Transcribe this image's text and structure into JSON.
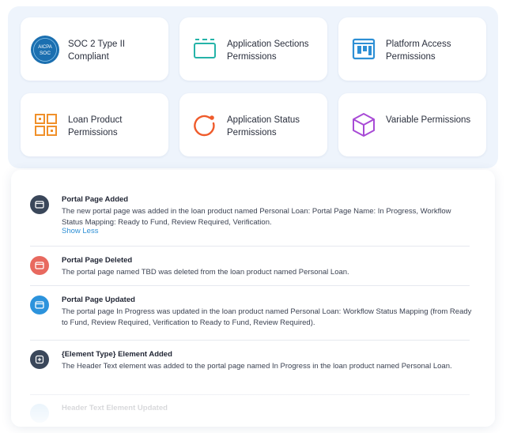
{
  "cards": [
    {
      "label": "SOC 2 Type II Compliant",
      "icon": "aicpa-soc-badge-icon"
    },
    {
      "label": "Application Sections Permissions",
      "icon": "sections-icon"
    },
    {
      "label": "Platform Access Permissions",
      "icon": "board-icon"
    },
    {
      "label": "Loan Product Permissions",
      "icon": "grid-icon"
    },
    {
      "label": "Application Status Permissions",
      "icon": "status-ring-icon"
    },
    {
      "label": "Variable Permissions",
      "icon": "cube-icon"
    }
  ],
  "badge": {
    "line1": "AICPA",
    "line2": "SOC"
  },
  "activity": [
    {
      "title": "Portal Page Added",
      "desc": "The new portal page was added in the loan product named Personal Loan: Portal Page Name: In Progress, Workflow Status Mapping: Ready to Fund, Review Required, Verification.",
      "link": "Show Less",
      "icon": "page-icon",
      "color": "#3a475a"
    },
    {
      "title": "Portal Page Deleted",
      "desc": "The portal page named TBD was deleted from the loan product named Personal Loan.",
      "icon": "page-icon",
      "color": "#e8695f"
    },
    {
      "title": "Portal Page Updated",
      "desc": "The portal page In Progress was updated in the loan product named Personal Loan: Workflow Status Mapping (from Ready to Fund, Review Required, Verification to Ready to Fund, Review Required).",
      "icon": "page-icon",
      "color": "#2c93dc"
    },
    {
      "title": "{Element Type} Element Added",
      "desc": "The Header Text element was added to the portal page named In Progress in the loan product named Personal Loan.",
      "icon": "add-element-icon",
      "color": "#3a475a"
    },
    {
      "title": "Header Text Element Updated",
      "icon": "page-icon",
      "color": "#9fcdef"
    }
  ],
  "colors": {
    "accent_blue": "#2d8fd5",
    "orange": "#f0902a",
    "red_orange": "#ef5b2b",
    "purple": "#a84bd6"
  }
}
